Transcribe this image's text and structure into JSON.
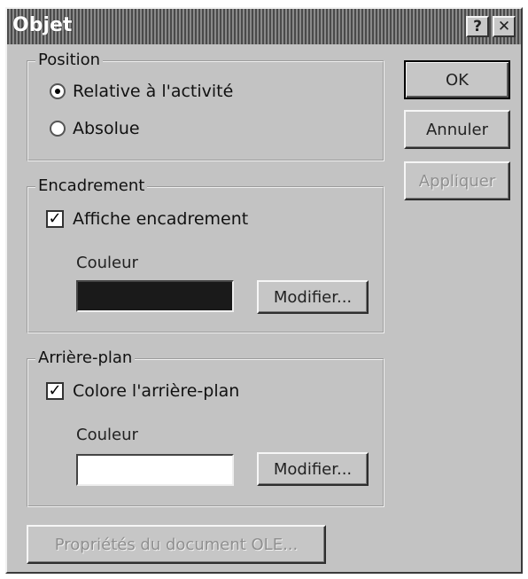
{
  "window": {
    "title": "Objet",
    "help_glyph": "?",
    "close_glyph": "✕"
  },
  "position_group": {
    "legend": "Position",
    "options": [
      {
        "label": "Relative à l'activité",
        "selected": true
      },
      {
        "label": "Absolue",
        "selected": false
      }
    ]
  },
  "encadrement_group": {
    "legend": "Encadrement",
    "checkbox_label": "Affiche encadrement",
    "checked": true,
    "couleur_label": "Couleur",
    "color": "#1a1a1a",
    "modify_label": "Modifier..."
  },
  "arriere_plan_group": {
    "legend": "Arrière-plan",
    "checkbox_label": "Colore l'arrière-plan",
    "checked": true,
    "couleur_label": "Couleur",
    "color": "#ffffff",
    "modify_label": "Modifier..."
  },
  "buttons": {
    "ok": "OK",
    "cancel": "Annuler",
    "apply": "Appliquer",
    "ole_properties": "Propriétés du document OLE..."
  },
  "checkmark_glyph": "✓"
}
